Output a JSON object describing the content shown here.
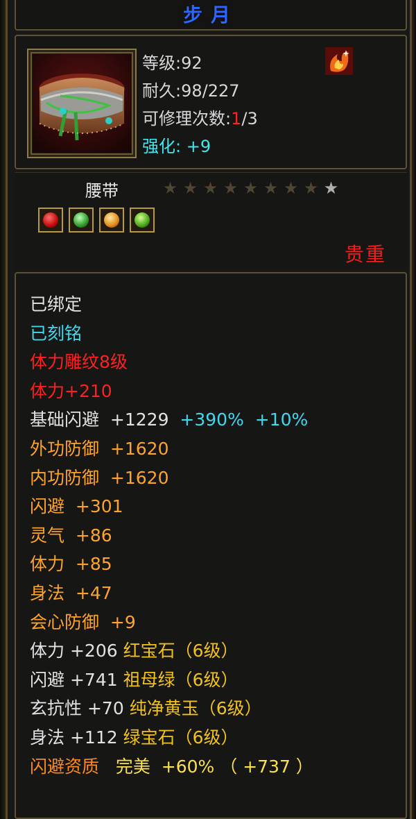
{
  "title": "步月",
  "header": {
    "level": "等级:92",
    "durability": "耐久:98/227",
    "repair_label": "可修理次数:",
    "repair_current": "1",
    "repair_total": "/3",
    "enhance_label": "强化:",
    "enhance_value": "+9"
  },
  "item_icon": "belt-item-icon",
  "item_type": "腰带",
  "stars": {
    "total": 9,
    "lit": 1
  },
  "sockets": [
    "red-gem",
    "green-gem",
    "yellow-gem",
    "emerald-gem"
  ],
  "rarity": "贵重",
  "attributes": {
    "bound": "已绑定",
    "engraved": "已刻铭",
    "carving": "体力雕纹8级",
    "carving_bonus": "体力+210",
    "base_dodge": {
      "label": "基础闪避",
      "value": "+1229",
      "pct1": "+390%",
      "pct2": "+10%"
    },
    "lines": [
      {
        "label": "外功防御",
        "value": "+1620"
      },
      {
        "label": "内功防御",
        "value": "+1620"
      },
      {
        "label": "闪避",
        "value": "+301"
      },
      {
        "label": "灵气",
        "value": "+86"
      },
      {
        "label": "体力",
        "value": "+85"
      },
      {
        "label": "身法",
        "value": "+47"
      },
      {
        "label": "会心防御",
        "value": "+9"
      }
    ],
    "gems": [
      {
        "stat": "体力",
        "value": "+206",
        "gem": "红宝石（6级）"
      },
      {
        "stat": "闪避",
        "value": "+741",
        "gem": "祖母绿（6级）"
      },
      {
        "stat": "玄抗性",
        "value": "+70",
        "gem": "纯净黄玉（6级）"
      },
      {
        "stat": "身法",
        "value": "+112",
        "gem": "绿宝石（6级）"
      }
    ],
    "aptitude": {
      "label": "闪避资质",
      "grade": "完美",
      "pct": "+60%",
      "bonus": "（ +737 ）"
    }
  }
}
